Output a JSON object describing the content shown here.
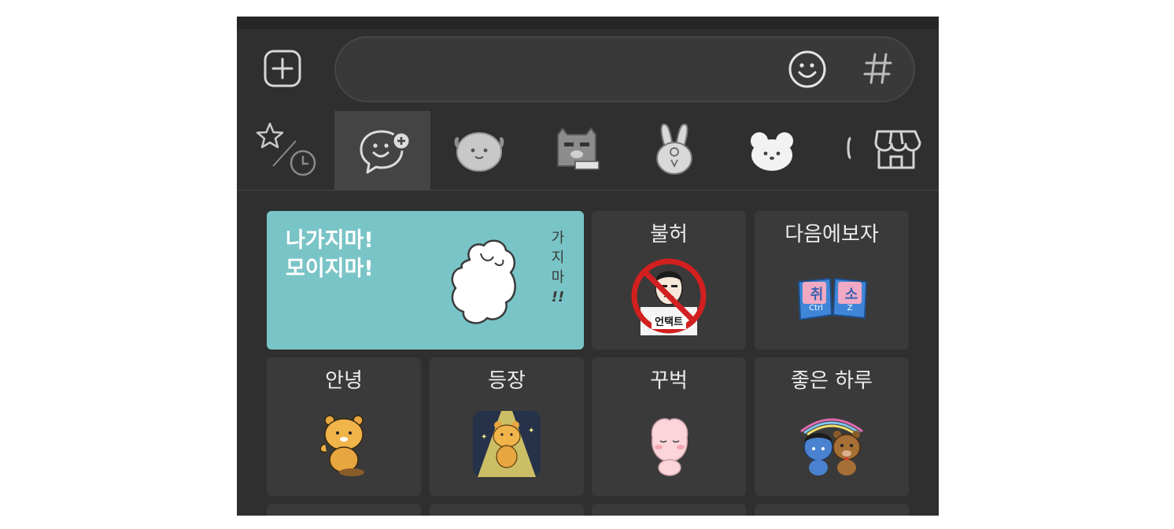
{
  "input": {
    "placeholder": "",
    "value": ""
  },
  "icons": {
    "plus": "plus-square-icon",
    "emoji": "smiley-icon",
    "hash": "hashtag-icon",
    "favorites": "star-clock-icon",
    "store": "store-icon"
  },
  "colors": {
    "panel": "#2f2f2f",
    "banner": "#79c4c6",
    "no_sign": "#d21f1f"
  },
  "tabs": [
    {
      "icon": "favorites-recent-icon",
      "active": false
    },
    {
      "icon": "emoticon-plus-icon",
      "active": true
    },
    {
      "icon": "puppy-sticker-icon",
      "active": false
    },
    {
      "icon": "grumpy-character-sticker-icon",
      "active": false
    },
    {
      "icon": "rabbit-sticker-icon",
      "active": false
    },
    {
      "icon": "mouse-sticker-icon",
      "active": false
    },
    {
      "icon": "store-icon",
      "active": false
    }
  ],
  "banner": {
    "title": "나가지마!\n모이지마!",
    "vertical_chars": [
      "가",
      "지",
      "마",
      "!!"
    ]
  },
  "stickers": [
    {
      "label": "불허",
      "image_text": "언택트",
      "icon": "no-sign-sticker"
    },
    {
      "label": "다음에보자",
      "image_text": [
        "취",
        "소",
        "Ctrl",
        "Z"
      ],
      "icon": "ctrl-z-keys-sticker"
    },
    {
      "label": "안녕",
      "icon": "ryan-wave-sticker"
    },
    {
      "label": "등장",
      "icon": "ryan-spotlight-sticker"
    },
    {
      "label": "꾸벅",
      "icon": "apeach-bow-sticker"
    },
    {
      "label": "좋은 하루",
      "icon": "neo-frodo-sticker"
    }
  ]
}
